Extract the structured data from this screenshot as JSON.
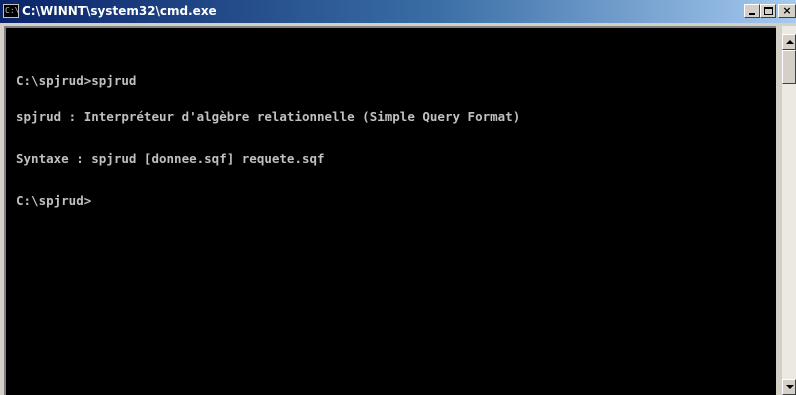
{
  "window": {
    "title": "C:\\WINNT\\system32\\cmd.exe",
    "app_icon_glyph": "C:\\",
    "controls": {
      "minimize": "minimize-icon",
      "maximize": "maximize-icon",
      "close_label": "×"
    }
  },
  "console": {
    "lines": [
      "C:\\spjrud>spjrud",
      "spjrud : Interpréteur d'algèbre relationnelle (Simple Query Format)",
      "Syntaxe : spjrud [donnee.sqf] requete.sqf",
      "C:\\spjrud>"
    ]
  },
  "colors": {
    "console_background": "#000000",
    "console_text": "#c0c0c0",
    "titlebar_start": "#0a246a",
    "titlebar_end": "#a6caf0",
    "chrome": "#d4d0c8"
  }
}
